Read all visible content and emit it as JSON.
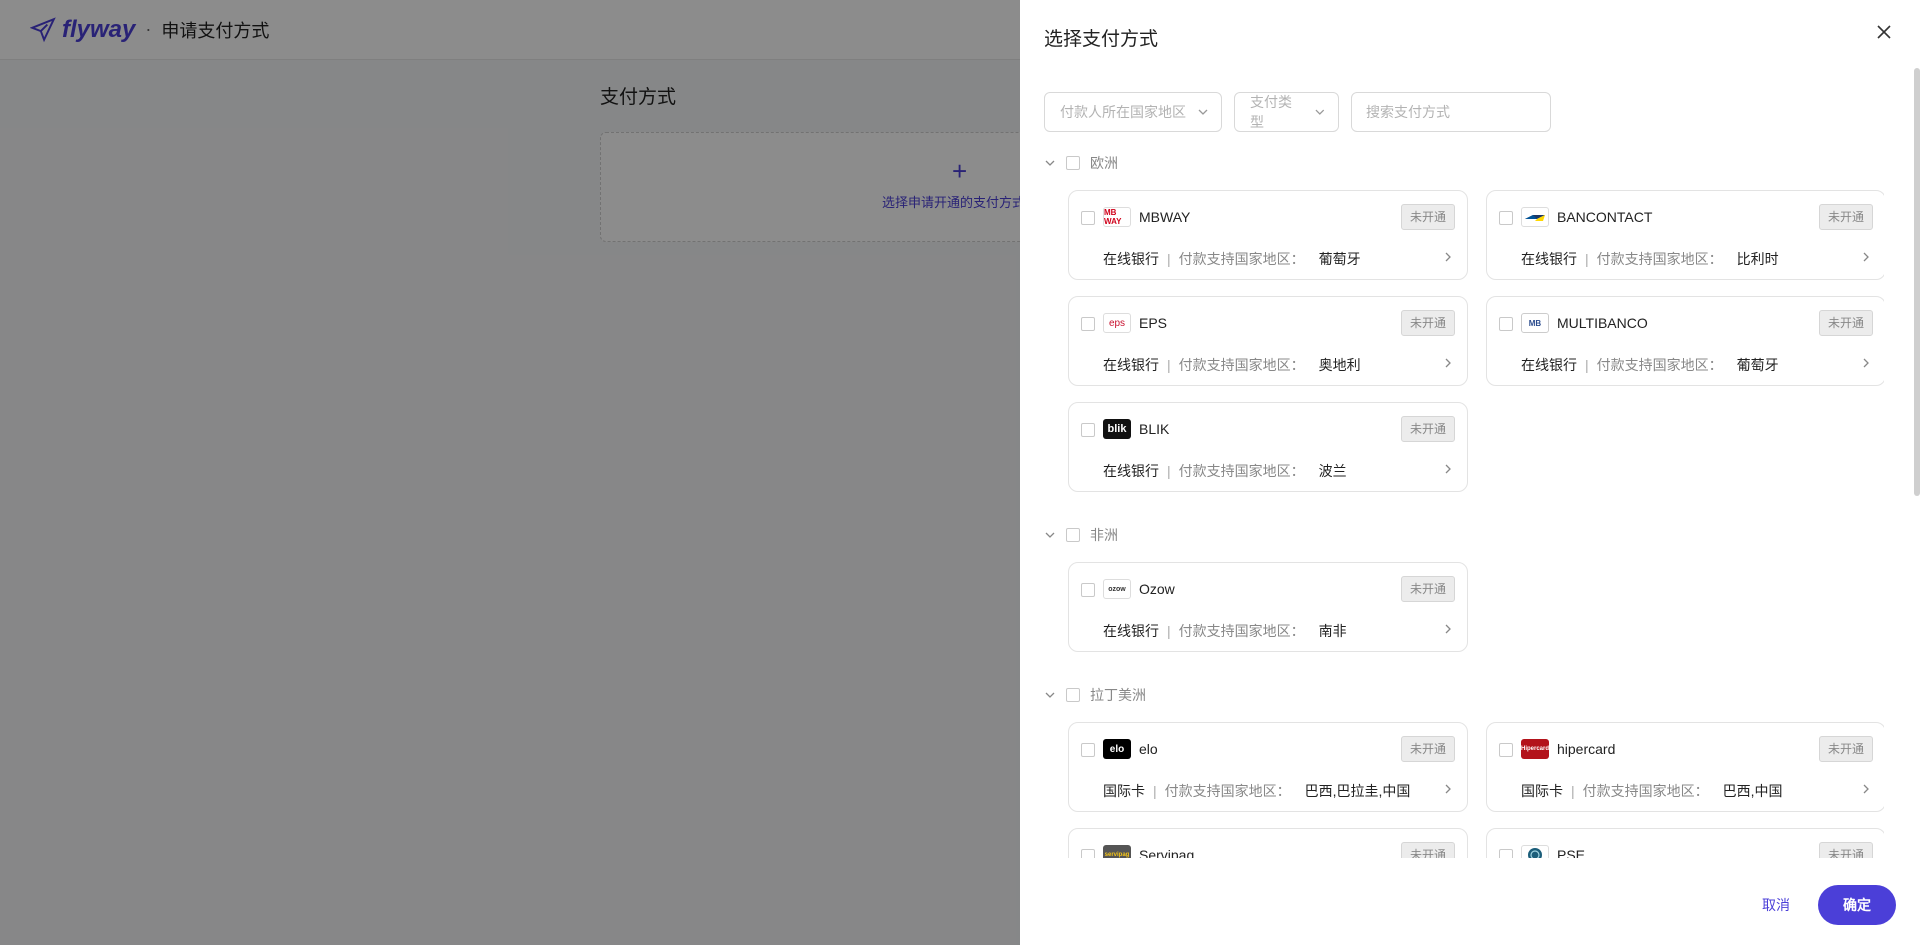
{
  "app": {
    "brand": "flyway",
    "separator": "·",
    "page_name": "申请支付方式"
  },
  "background": {
    "section_title": "支付方式",
    "add_plus": "+",
    "add_label": "选择申请开通的支付方式"
  },
  "drawer": {
    "title": "选择支付方式",
    "filters": {
      "country_placeholder": "付款人所在国家地区",
      "type_placeholder": "支付类型",
      "search_placeholder": "搜索支付方式"
    },
    "countries_label": "付款支持国家地区：",
    "groups": [
      {
        "name": "欧洲",
        "items": [
          {
            "name": "MBWAY",
            "logo_text": "MB WAY",
            "status": "未开通",
            "type": "在线银行",
            "countries": "葡萄牙"
          },
          {
            "name": "BANCONTACT",
            "logo_text": "",
            "status": "未开通",
            "type": "在线银行",
            "countries": "比利时"
          },
          {
            "name": "EPS",
            "logo_text": "eps",
            "status": "未开通",
            "type": "在线银行",
            "countries": "奥地利"
          },
          {
            "name": "MULTIBANCO",
            "logo_text": "MB",
            "status": "未开通",
            "type": "在线银行",
            "countries": "葡萄牙"
          },
          {
            "name": "BLIK",
            "logo_text": "blik",
            "status": "未开通",
            "type": "在线银行",
            "countries": "波兰"
          }
        ]
      },
      {
        "name": "非洲",
        "items": [
          {
            "name": "Ozow",
            "logo_text": "ozow",
            "status": "未开通",
            "type": "在线银行",
            "countries": "南非"
          }
        ]
      },
      {
        "name": "拉丁美洲",
        "items": [
          {
            "name": "elo",
            "logo_text": "elo",
            "status": "未开通",
            "type": "国际卡",
            "countries": "巴西,巴拉圭,中国"
          },
          {
            "name": "hipercard",
            "logo_text": "Hipercard",
            "status": "未开通",
            "type": "国际卡",
            "countries": "巴西,中国"
          },
          {
            "name": "Servipag",
            "logo_text": "servipag",
            "status": "未开通",
            "type": "",
            "countries": ""
          },
          {
            "name": "PSE",
            "logo_text": "",
            "status": "未开通",
            "type": "",
            "countries": ""
          }
        ]
      }
    ],
    "footer": {
      "cancel_label": "取消",
      "ok_label": "确定"
    }
  },
  "colors": {
    "accent": "#4b3fd8",
    "overlay": "rgba(0,0,0,0.45)",
    "badge_bg": "#ececec"
  },
  "icons": {
    "close": "close-icon",
    "chevron": "chevron-down-icon",
    "arrow": "chevron-right-icon",
    "logo": "paper-plane-icon"
  }
}
